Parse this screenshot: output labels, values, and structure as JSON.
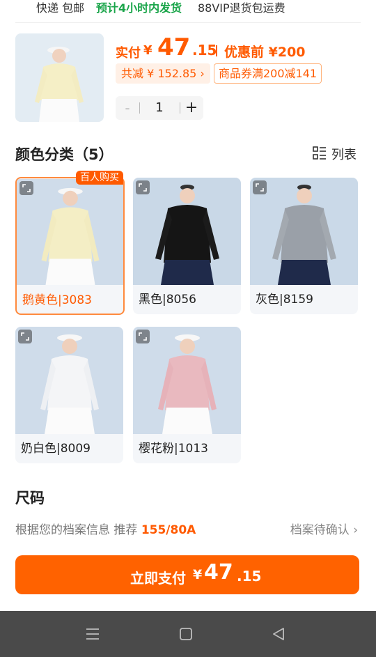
{
  "top": {
    "shipping": "快递 包邮",
    "ship_time": "预计4小时内发货",
    "vip": "88VIP退货包运费"
  },
  "summary": {
    "paid_label": "实付",
    "currency": "¥",
    "price_int": "47",
    "price_dec": ".15",
    "before_label": "优惠前",
    "before_price": "¥200",
    "discount_chip": "共减 ¥ 152.85 ›",
    "coupon_chip": "商品券满200减141",
    "quantity": "1",
    "minus": "-",
    "plus": "+"
  },
  "colors": {
    "title": "颜色分类（5）",
    "view_toggle": "列表",
    "hot_badge": "百人购买",
    "items": [
      {
        "label": "鹅黄色|3083",
        "selected": true
      },
      {
        "label": "黑色|8056",
        "selected": false
      },
      {
        "label": "灰色|8159",
        "selected": false
      },
      {
        "label": "奶白色|8009",
        "selected": false
      },
      {
        "label": "樱花粉|1013",
        "selected": false
      }
    ]
  },
  "size": {
    "title": "尺码",
    "recommend_prefix": "根据您的档案信息 推荐",
    "recommend_value": "155/80A",
    "confirm_link": "档案待确认 ›"
  },
  "pay_button": {
    "label": "立即支付",
    "currency": "¥",
    "price_int": "47",
    "price_dec": ".15"
  },
  "theme": {
    "accent": "#ff5a00",
    "button": "#ff6200",
    "green": "#1aa54a"
  },
  "icons": [
    "zoom-icon",
    "list-view-icon",
    "chevron-right-icon",
    "menu-nav-icon",
    "home-nav-icon",
    "back-nav-icon"
  ]
}
